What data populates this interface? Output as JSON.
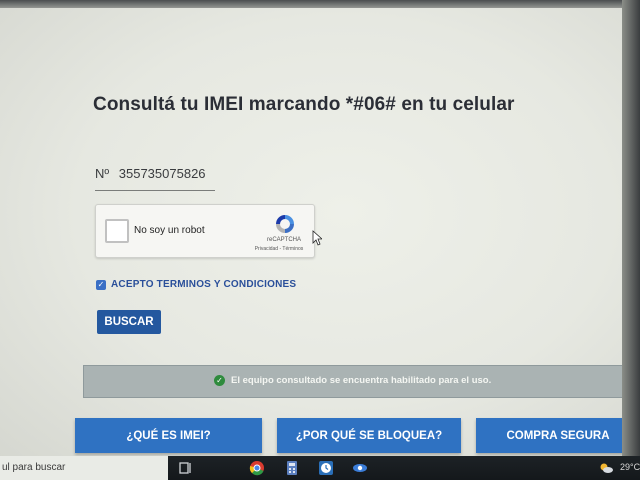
{
  "page": {
    "title": "Consultá tu IMEI marcando *#06# en tu celular"
  },
  "imei": {
    "prefix": "Nº",
    "value": "355735075826"
  },
  "captcha": {
    "label": "No soy un robot",
    "brand": "reCAPTCHA",
    "links": "Privacidad - Términos",
    "checked": false
  },
  "terms": {
    "checked": true,
    "label": "ACEPTO TERMINOS Y CONDICIONES"
  },
  "search_button": {
    "label": "BUSCAR"
  },
  "result": {
    "message": "El equipo consultado se encuentra habilitado para el uso.",
    "status_color": "#2e8b3d"
  },
  "nav_buttons": [
    {
      "label": "¿QUÉ ES IMEI?"
    },
    {
      "label": "¿POR QUÉ SE BLOQUEA?"
    },
    {
      "label": "COMPRA SEGURA"
    }
  ],
  "taskbar": {
    "search_placeholder": "ul para buscar",
    "temperature": "29°C",
    "icons": [
      "task-view-icon",
      "chrome-icon",
      "calculator-icon",
      "clock-icon",
      "network-app-icon",
      "weather-icon"
    ]
  },
  "colors": {
    "accent_blue": "#2f72c2",
    "button_dark_blue": "#24589f",
    "terms_text": "#2a4f9a"
  }
}
